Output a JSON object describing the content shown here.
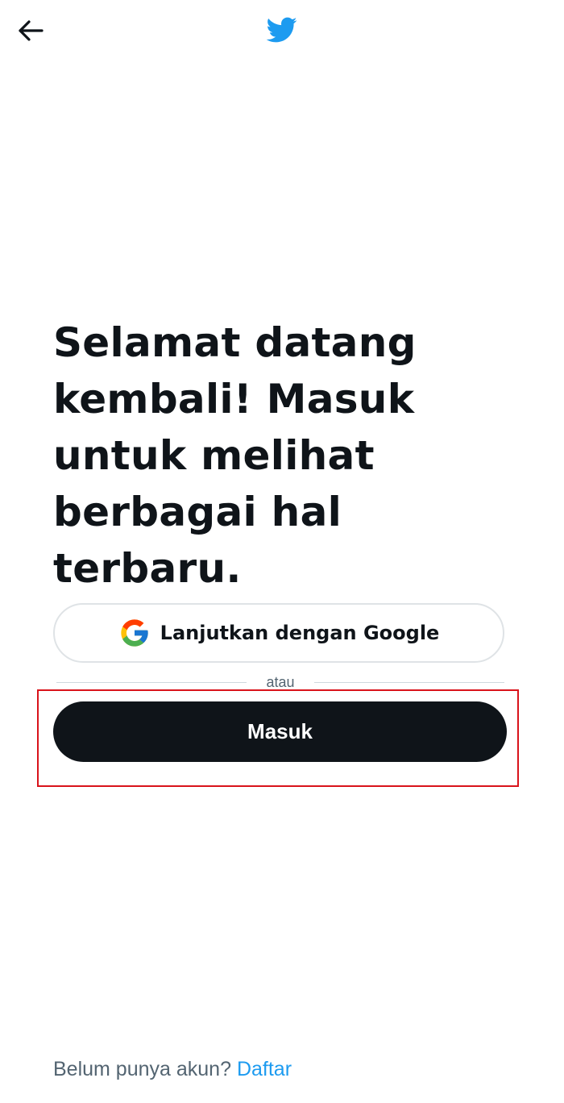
{
  "header": {
    "back_icon": "arrow-left-icon",
    "logo_icon": "twitter-bird-icon",
    "brand_color": "#1d9bf0"
  },
  "main": {
    "headline": "Selamat datang kembali! Masuk untuk melihat berbagai hal terbaru.",
    "google_button": {
      "label": "Lanjutkan dengan Google",
      "icon": "google-g-icon"
    },
    "divider_text": "atau",
    "login_button_label": "Masuk",
    "highlight_color": "#d9131b"
  },
  "footer": {
    "prompt": "Belum punya akun?",
    "signup_link": "Daftar",
    "link_color": "#1d9bf0"
  }
}
